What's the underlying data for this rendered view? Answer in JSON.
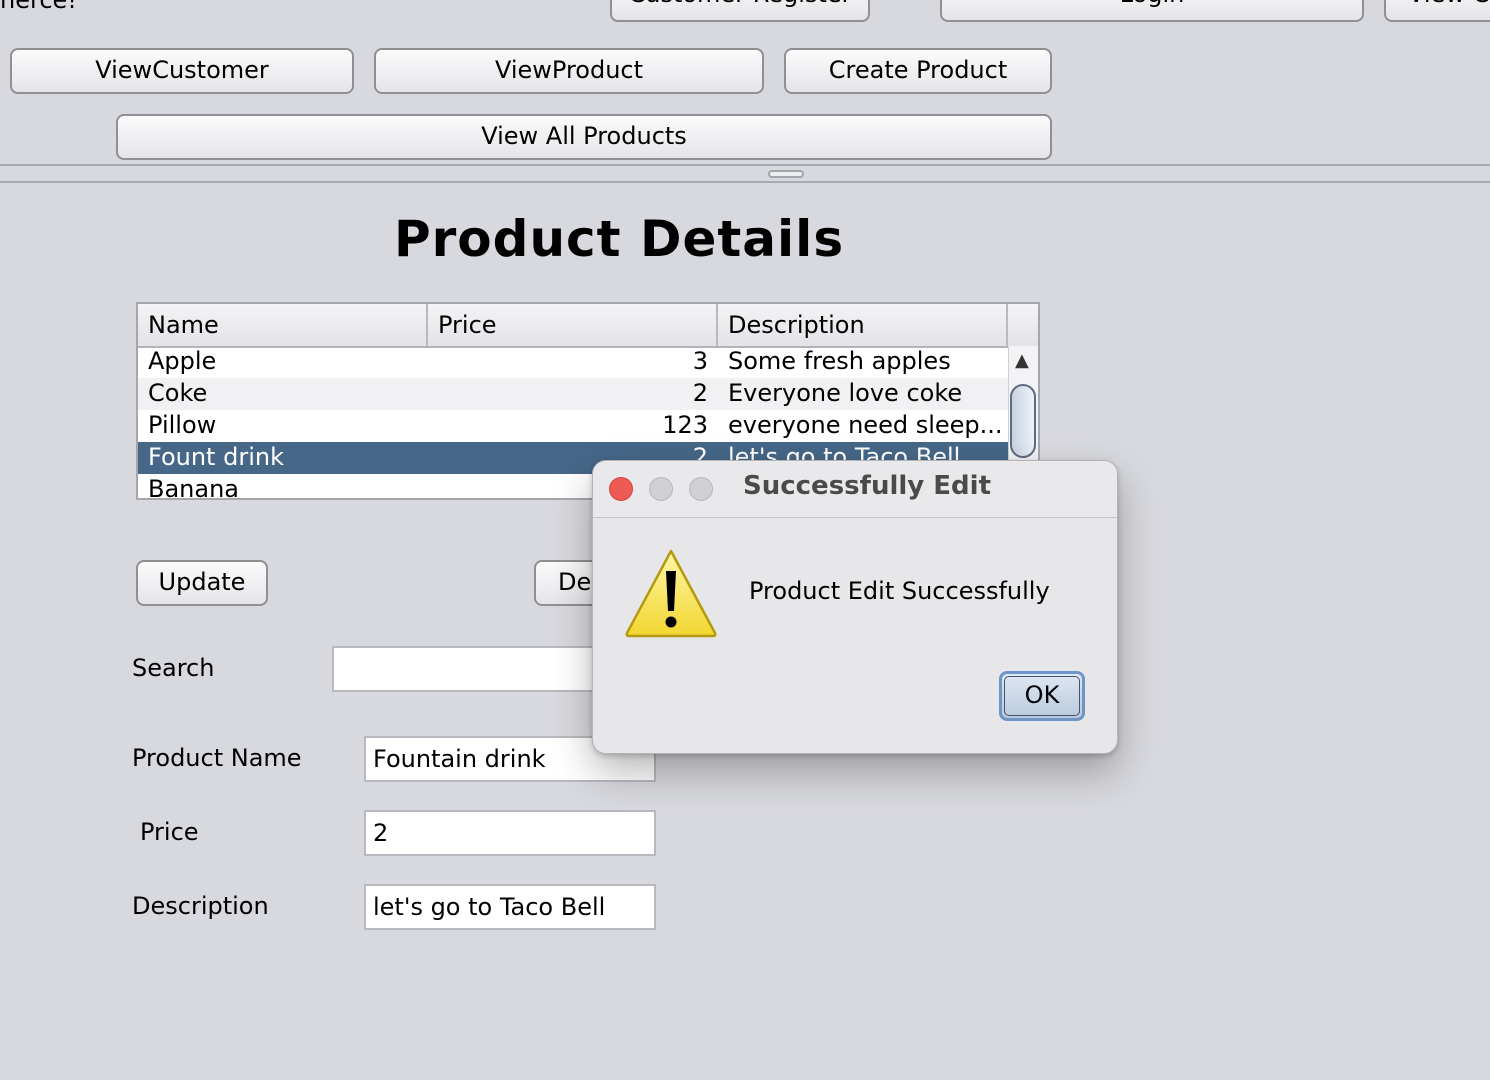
{
  "header": {
    "cut_text_left": "nerce!",
    "buttons_top": [
      "Customer Register",
      "Login",
      "View Ca"
    ],
    "buttons": {
      "view_customer": "ViewCustomer",
      "view_product": "ViewProduct",
      "create_product": "Create Product",
      "view_all_products": "View All Products"
    }
  },
  "main": {
    "title": "Product Details",
    "table": {
      "columns": [
        "Name",
        "Price",
        "Description"
      ],
      "rows": [
        {
          "name": "Apple",
          "price": "3",
          "description": "Some fresh apples"
        },
        {
          "name": "Coke",
          "price": "2",
          "description": "Everyone love coke"
        },
        {
          "name": "Pillow",
          "price": "123",
          "description": "everyone need sleep..."
        },
        {
          "name": "Fount drink",
          "price": "2",
          "description": "let's go to Taco Bell"
        },
        {
          "name": "Banana",
          "price": "",
          "description": ""
        }
      ],
      "selected_row": "Fount drink"
    },
    "update_button": "Update",
    "delete_button_partial": "De",
    "search": {
      "label": "Search",
      "value": ""
    },
    "form": {
      "product_name_label": "Product Name",
      "product_name_value": "Fountain drink",
      "price_label": "Price",
      "price_value": "2",
      "description_label": "Description",
      "description_value": "let's go to Taco Bell"
    }
  },
  "dialog": {
    "title": "Successfully Edit",
    "message": "Product Edit Successfully",
    "ok_label": "OK",
    "icon": "warning-icon"
  }
}
